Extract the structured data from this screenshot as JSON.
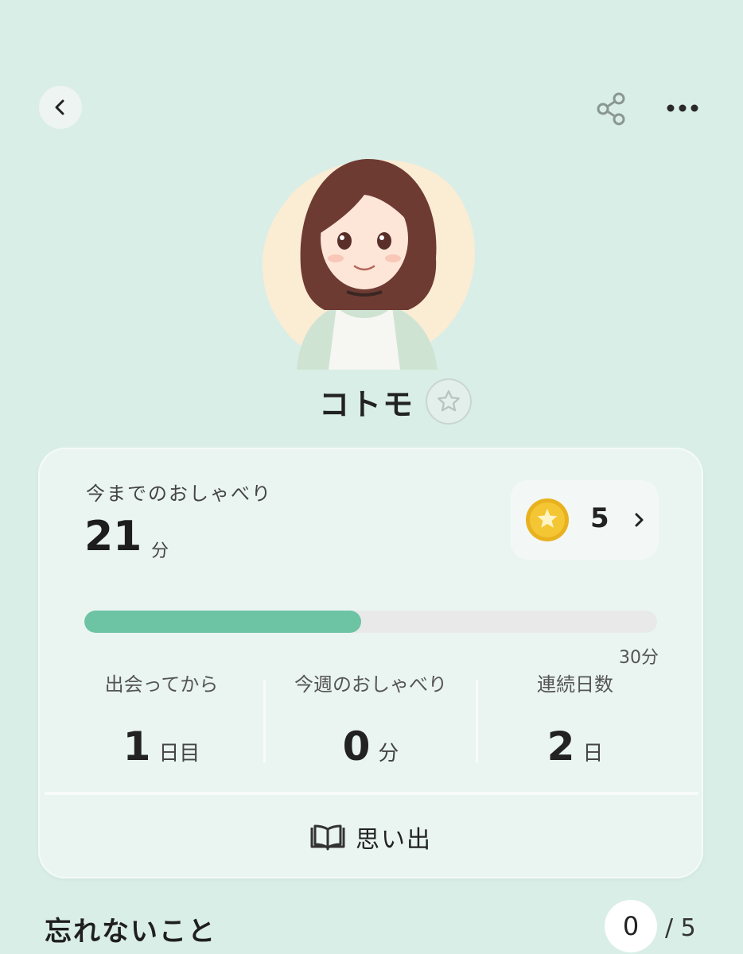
{
  "header": {
    "back_icon": "chevron-left-icon",
    "share_icon": "share-icon",
    "more_icon": "more-horizontal-icon"
  },
  "profile": {
    "name": "コトモ",
    "favorite_icon": "star-outline-icon"
  },
  "stats_card": {
    "total_label": "今までのおしゃべり",
    "total_value": "21",
    "total_unit": "分",
    "coins": {
      "icon": "star-coin-icon",
      "count": "5"
    },
    "progress": {
      "fraction": 0.483,
      "max_label": "30分",
      "fill_color": "#6cc4a4"
    },
    "stats": [
      {
        "label": "出会ってから",
        "value": "1",
        "unit": "日目"
      },
      {
        "label": "今週のおしゃべり",
        "value": "0",
        "unit": "分"
      },
      {
        "label": "連続日数",
        "value": "2",
        "unit": "日"
      }
    ],
    "memories_label": "思い出",
    "memories_icon": "open-book-icon"
  },
  "remember_section": {
    "title": "忘れないこと",
    "current": "0",
    "total": "/ 5"
  },
  "colors": {
    "background": "#d9eee7",
    "card": "#eaf5f1",
    "accent": "#6cc4a4"
  }
}
